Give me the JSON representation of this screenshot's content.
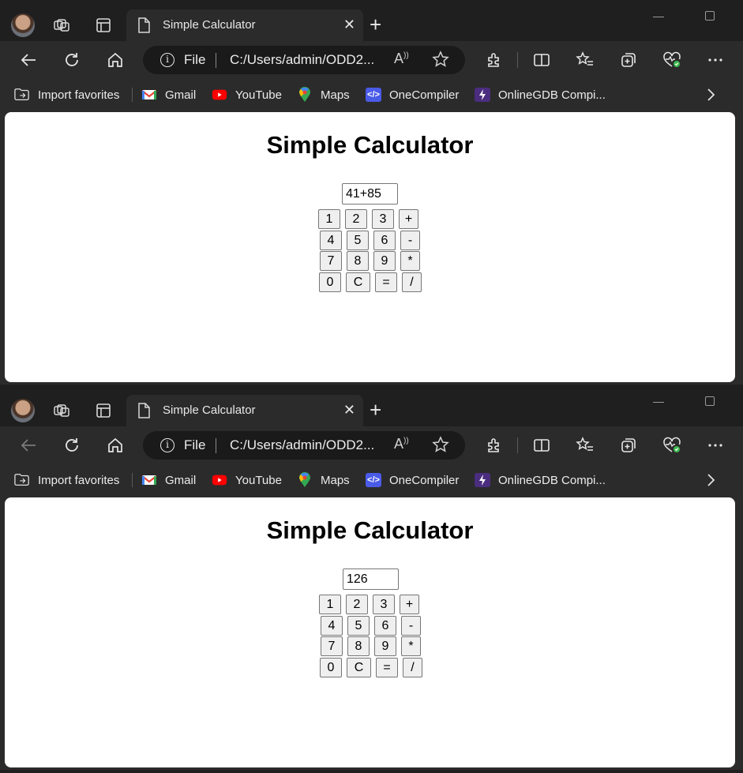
{
  "windows": [
    {
      "tab": {
        "title": "Simple Calculator"
      },
      "address": {
        "scheme_label": "File",
        "url": "C:/Users/admin/ODD2..."
      },
      "favorites": [
        "Import favorites",
        "Gmail",
        "YouTube",
        "Maps",
        "OneCompiler",
        "OnlineGDB Compi..."
      ],
      "page": {
        "heading": "Simple Calculator",
        "display": "41+85",
        "keys": [
          [
            "1",
            "2",
            "3",
            "+"
          ],
          [
            "4",
            "5",
            "6",
            "-"
          ],
          [
            "7",
            "8",
            "9",
            "*"
          ],
          [
            "0",
            "C",
            "=",
            "/"
          ]
        ]
      }
    },
    {
      "tab": {
        "title": "Simple Calculator"
      },
      "address": {
        "scheme_label": "File",
        "url": "C:/Users/admin/ODD2..."
      },
      "favorites": [
        "Import favorites",
        "Gmail",
        "YouTube",
        "Maps",
        "OneCompiler",
        "OnlineGDB Compi..."
      ],
      "page": {
        "heading": "Simple Calculator",
        "display": "126",
        "keys": [
          [
            "1",
            "2",
            "3",
            "+"
          ],
          [
            "4",
            "5",
            "6",
            "-"
          ],
          [
            "7",
            "8",
            "9",
            "*"
          ],
          [
            "0",
            "C",
            "=",
            "/"
          ]
        ]
      }
    }
  ],
  "colors": {
    "chrome_dark": "#1f1f1f",
    "chrome": "#2b2b2b",
    "page_bg": "#ffffff",
    "key_bg": "#efefef"
  },
  "icons": [
    "profile-avatar",
    "workspaces-icon",
    "tab-actions-icon",
    "page-icon",
    "close-icon",
    "plus-icon",
    "back-arrow-icon",
    "refresh-icon",
    "home-icon",
    "info-icon",
    "read-aloud-icon",
    "star-icon",
    "extensions-icon",
    "split-screen-icon",
    "favorites-icon",
    "collections-icon",
    "browser-essentials-icon",
    "more-icon",
    "folder-import-icon",
    "gmail-icon",
    "youtube-icon",
    "maps-icon",
    "onecompiler-icon",
    "onlinegdb-icon",
    "chevron-right-icon"
  ]
}
